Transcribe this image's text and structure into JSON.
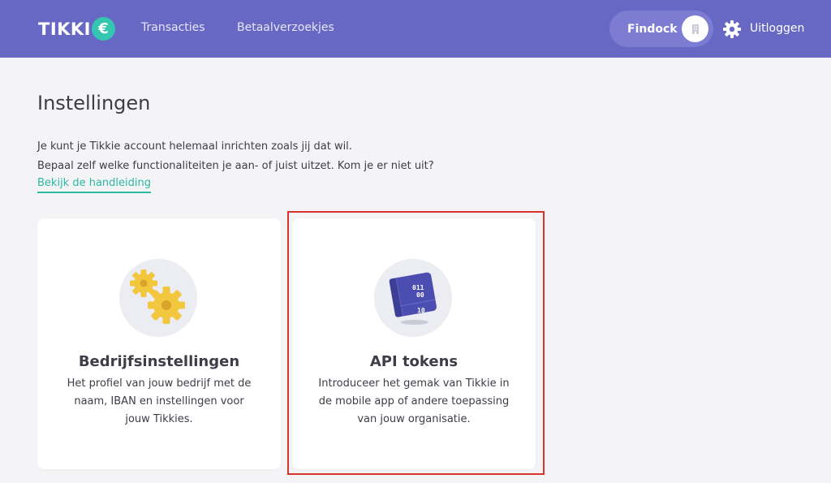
{
  "header": {
    "logo_text": "TIKKI",
    "logo_badge": "€",
    "nav": [
      "Transacties",
      "Betaalverzoekjes"
    ],
    "company_name": "Findock",
    "logout_label": "Uitloggen"
  },
  "page": {
    "title": "Instellingen",
    "intro_line1": "Je kunt je Tikkie account helemaal inrichten zoals jij dat wil.",
    "intro_line2": "Bepaal zelf welke functionaliteiten je aan- of juist uitzet. Kom je er niet uit?",
    "manual_link": "Bekijk de handleiding"
  },
  "cards": [
    {
      "title": "Bedrijfsinstellingen",
      "description": "Het profiel van jouw bedrijf met de naam, IBAN en instellingen voor jouw Tikkies.",
      "icon": "gears-icon"
    },
    {
      "title": "API tokens",
      "description": "Introduceer het gemak van Tikkie in de mobile app of andere toepassing van jouw organisatie.",
      "icon": "binary-book-icon",
      "icon_text": [
        "011",
        "00",
        "10"
      ]
    }
  ],
  "colors": {
    "header": "#6768c4",
    "accent": "#2bb9a3",
    "highlight": "#d9342b"
  }
}
